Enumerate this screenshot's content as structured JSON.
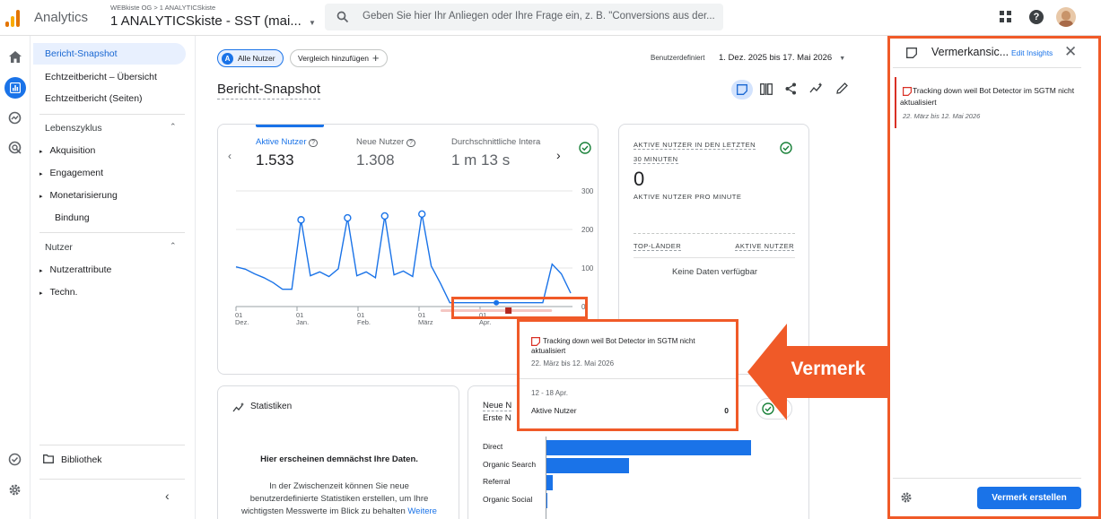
{
  "app": {
    "name": "Analytics",
    "account_path": "WEBkiste OG > 1 ANALYTICSkiste",
    "property": "1 ANALYTICSkiste - SST (mai...",
    "search_placeholder": "Geben Sie hier Ihr Anliegen oder Ihre Frage ein, z. B. \"Conversions aus der..."
  },
  "nav": {
    "items_top": [
      "Bericht-Snapshot",
      "Echtzeitbericht – Übersicht",
      "Echtzeitbericht (Seiten)"
    ],
    "lifecycle_header": "Lebenszyklus",
    "lifecycle_items": [
      "Akquisition",
      "Engagement",
      "Monetarisierung",
      "Bindung"
    ],
    "user_header": "Nutzer",
    "user_items": [
      "Nutzerattribute",
      "Techn."
    ],
    "library": "Bibliothek"
  },
  "toolbar": {
    "segment": "Alle Nutzer",
    "segment_badge": "A",
    "compare": "Vergleich hinzufügen",
    "date_label": "Benutzerdefiniert",
    "date_range": "1. Dez. 2025 bis 17. Mai 2026",
    "page_title": "Bericht-Snapshot"
  },
  "metrics": [
    {
      "label": "Aktive Nutzer",
      "value": "1.533"
    },
    {
      "label": "Neue Nutzer",
      "value": "1.308"
    },
    {
      "label": "Durchschnittliche Intera",
      "value": "1 m 13 s"
    }
  ],
  "chart_data": {
    "type": "line",
    "x_ticks": [
      {
        "day": "01",
        "month": "Dez."
      },
      {
        "day": "01",
        "month": "Jan."
      },
      {
        "day": "01",
        "month": "Feb."
      },
      {
        "day": "01",
        "month": "März"
      },
      {
        "day": "01",
        "month": "Apr."
      }
    ],
    "y_ticks": [
      "300",
      "200",
      "100",
      "0"
    ],
    "ylim": [
      0,
      300
    ],
    "series": [
      {
        "values": [
          103,
          97,
          85,
          75,
          62,
          45,
          45,
          225,
          80,
          90,
          78,
          98,
          230,
          80,
          90,
          75,
          235,
          82,
          92,
          78,
          240,
          105,
          60,
          10,
          10,
          10,
          10,
          10,
          10,
          10,
          10,
          10,
          10,
          10,
          110,
          85,
          35
        ]
      }
    ],
    "annotation_marker_color": "#b3261e"
  },
  "realtime": {
    "title_line1": "AKTIVE NUTZER IN DEN LETZTEN",
    "title_line2": "30 MINUTEN",
    "value": "0",
    "subtitle": "AKTIVE NUTZER PRO MINUTE",
    "col1": "TOP-LÄNDER",
    "col2": "AKTIVE NUTZER",
    "empty": "Keine Daten verfügbar"
  },
  "stats": {
    "title": "Statistiken",
    "headline": "Hier erscheinen demnächst Ihre Daten.",
    "body_line1": "In der Zwischenzeit können Sie neue",
    "body_line2": "benutzerdefinierte Statistiken erstellen, um Ihre",
    "body_line3": "wichtigsten Messwerte im Blick zu behalten",
    "link": "Weitere"
  },
  "channels": {
    "title_line1": "Neue N",
    "title_line2": "Erste N",
    "rows": [
      {
        "label": "Direct",
        "value": 0.74
      },
      {
        "label": "Organic Search",
        "value": 0.3
      },
      {
        "label": "Referral",
        "value": 0.025
      },
      {
        "label": "Organic Social",
        "value": 0.008
      }
    ]
  },
  "tooltip": {
    "title": "Tracking down weil Bot Detector im SGTM nicht aktualisiert",
    "dates": "22. März bis 12. Mai 2026",
    "period": "12 - 18 Apr.",
    "metric_label": "Aktive Nutzer",
    "metric_value": "0"
  },
  "callout": "Vermerk",
  "panel": {
    "title": "Vermerkansic...",
    "edit_link": "Edit Insights",
    "note_title": "Tracking down weil Bot Detector im SGTM nicht aktualisiert",
    "note_dates": "22. März bis 12. Mai 2026",
    "create_button": "Vermerk erstellen"
  },
  "colors": {
    "accent": "#1a73e8",
    "orange": "#f05a28",
    "note_red": "#d93025",
    "bar": "#1a73e8"
  }
}
